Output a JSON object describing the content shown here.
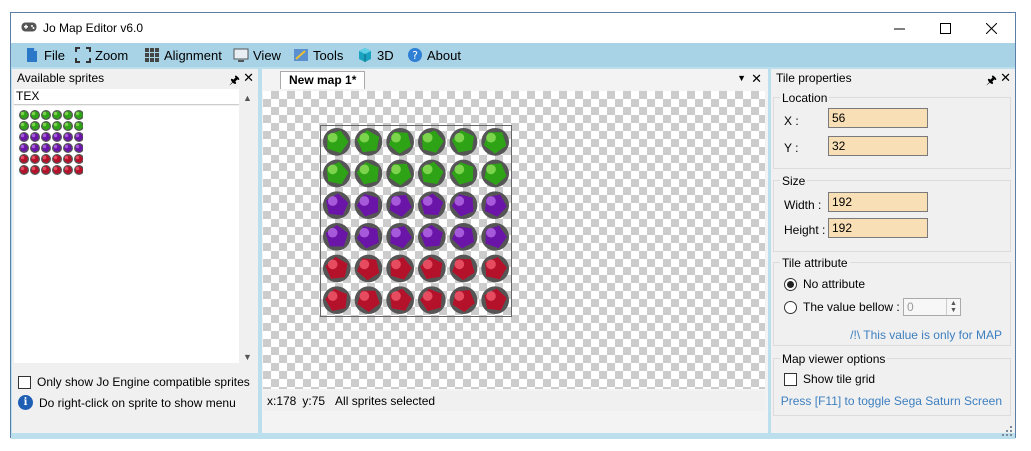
{
  "window": {
    "title": "Jo Map Editor v6.0"
  },
  "menu": [
    {
      "label": "File",
      "icon": "file-icon"
    },
    {
      "label": "Zoom",
      "icon": "zoom-icon"
    },
    {
      "label": "Alignment",
      "icon": "alignment-icon"
    },
    {
      "label": "View",
      "icon": "view-icon"
    },
    {
      "label": "Tools",
      "icon": "tools-icon"
    },
    {
      "label": "3D",
      "icon": "cube-icon"
    },
    {
      "label": "About",
      "icon": "help-icon"
    }
  ],
  "sprites_panel": {
    "title": "Available sprites",
    "filter": "TEX",
    "compat_label": "Only show Jo Engine compatible sprites",
    "hint": "Do right-click on sprite to show menu"
  },
  "document": {
    "tab_label": "New map 1*",
    "status_x": "x:178",
    "status_y": "y:75",
    "status_text": "All sprites selected"
  },
  "tile_props": {
    "title": "Tile properties",
    "location": {
      "label": "Location",
      "x_label": "X :",
      "x": "56",
      "y_label": "Y :",
      "y": "32"
    },
    "size": {
      "label": "Size",
      "width_label": "Width :",
      "width": "192",
      "height_label": "Height :",
      "height": "192"
    },
    "attribute": {
      "label": "Tile attribute",
      "no_attr": "No attribute",
      "value_below": "The value bellow :",
      "value": "0",
      "note": "/!\\ This value is only for MAP"
    },
    "viewer": {
      "label": "Map viewer options",
      "show_grid": "Show tile grid",
      "note": "Press [F11] to toggle Sega Saturn Screen"
    }
  },
  "colors": {
    "menubar": "#a8d3e6",
    "field_bg": "#f9dfb5",
    "link": "#3d7fc0"
  }
}
